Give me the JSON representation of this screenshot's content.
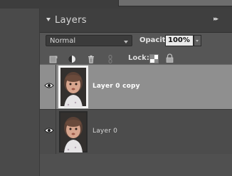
{
  "panel": {
    "title": "Layers",
    "menu_glyph": "▸▸"
  },
  "options": {
    "blend_mode": "Normal",
    "opacity_label": "Opacity:",
    "opacity_value": "100%",
    "lock_label": "Lock:"
  },
  "toolbar_icons": [
    "new-layer-icon",
    "adjustment-layer-icon",
    "trash-icon",
    "link-icon",
    "lock-transparency-icon",
    "lock-all-icon"
  ],
  "layers": [
    {
      "name": "Layer 0 copy",
      "visible": true,
      "selected": true
    },
    {
      "name": "Layer 0",
      "visible": true,
      "selected": false
    }
  ],
  "colors": {
    "panel_bg": "#505050",
    "header_bg": "#3f3f3f",
    "selected_row": "#8f8f8f",
    "unselected_row": "#4c4c4c"
  }
}
